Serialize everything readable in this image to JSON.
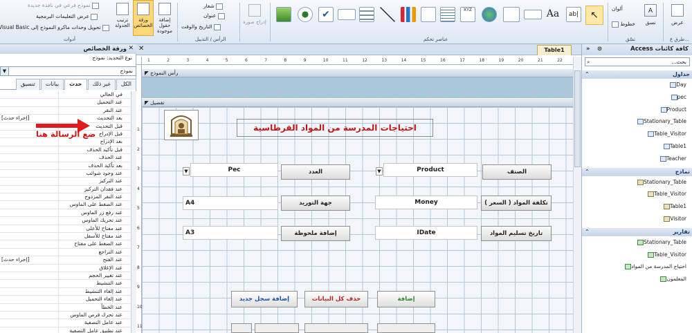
{
  "ribbon": {
    "groups": [
      {
        "label": "طرق ع..."
      },
      {
        "label": "نسّق"
      },
      {
        "label": "عناصر تحكم"
      },
      {
        "label": "الرأس / التذييل"
      },
      {
        "label": "أدوات"
      }
    ],
    "view_label": "عرض",
    "theme_label": "نسق",
    "colors_label": "ألوان",
    "fonts_label": "خطوط",
    "insert_image_label": "إدراج صورة",
    "logo_label": "شعار",
    "title_label": "عنوان",
    "datetime_label": "التاريخ والوقت",
    "add_fields_label": "إضافة حقول موجودة",
    "property_sheet_label": "ورقة الخصائص",
    "tab_order_label": "ترتيب الجدولة",
    "subform_label": "نموذج فرعي في نافذة جديدة",
    "view_code_label": "عرض التعليمات البرمجية",
    "convert_macros_label": "تحويل وحدات ماكرو النموذج إلى Visual Basic",
    "label_control": "Aa",
    "textbox_control": "ab|",
    "xyz_control": "XYZ"
  },
  "property_sheet": {
    "title": "ورقة الخصائص",
    "selection_type": "نوع التحديد: نموذج",
    "selected_object": "نموذج",
    "tabs": [
      "تنسيق",
      "بيانات",
      "حدث",
      "غير ذلك",
      "الكل"
    ],
    "active_tab": "حدث",
    "events": [
      {
        "name": "في الحالي",
        "value": ""
      },
      {
        "name": "عند التحميل",
        "value": ""
      },
      {
        "name": "عند النقر",
        "value": ""
      },
      {
        "name": "بعد التحديث",
        "value": "[إجراء حدث]"
      },
      {
        "name": "قبل التحديث",
        "value": ""
      },
      {
        "name": "قبل الإدراج",
        "value": ""
      },
      {
        "name": "بعد الإدراج",
        "value": ""
      },
      {
        "name": "قبل تأكيد الحذف",
        "value": ""
      },
      {
        "name": "عند الحذف",
        "value": ""
      },
      {
        "name": "بعد تأكيد الحذف",
        "value": ""
      },
      {
        "name": "عند وجود شوائب",
        "value": ""
      },
      {
        "name": "عند التركيز",
        "value": ""
      },
      {
        "name": "عند فقدان التركيز",
        "value": ""
      },
      {
        "name": "عند النقر المزدوج",
        "value": ""
      },
      {
        "name": "عند الضغط على الماوس",
        "value": ""
      },
      {
        "name": "عند رفع زر الماوس",
        "value": ""
      },
      {
        "name": "عند تحريك الماوس",
        "value": ""
      },
      {
        "name": "عند مفتاح للأعلى",
        "value": ""
      },
      {
        "name": "عند مفتاح للأسفل",
        "value": ""
      },
      {
        "name": "عند الضغط على مفتاح",
        "value": ""
      },
      {
        "name": "عند التراجع",
        "value": ""
      },
      {
        "name": "عند الفتح",
        "value": "[إجراء حدث]"
      },
      {
        "name": "عند الإغلاق",
        "value": ""
      },
      {
        "name": "عند تغيير الحجم",
        "value": ""
      },
      {
        "name": "عند التنشيط",
        "value": ""
      },
      {
        "name": "عند إلغاء التنشيط",
        "value": ""
      },
      {
        "name": "عند إلغاء التحميل",
        "value": ""
      },
      {
        "name": "عند الخطأ",
        "value": ""
      },
      {
        "name": "عند تحرك قرص الماوس",
        "value": ""
      },
      {
        "name": "عند عامل التصفية",
        "value": ""
      },
      {
        "name": "عند تطبيق عامل التصفية",
        "value": ""
      }
    ],
    "annotation": "ضع الرسالة هنا"
  },
  "document": {
    "tab_label": "Table1",
    "header_section": "رأس النموذج",
    "detail_section": "تفصيل",
    "ruler_numbers": [
      "1",
      "2",
      "3",
      "4",
      "5",
      "6",
      "7",
      "8",
      "9",
      "10",
      "11",
      "12",
      "13",
      "14",
      "15",
      "16",
      "17",
      "18",
      "19",
      "20",
      "21",
      "22"
    ],
    "vruler_numbers": [
      "1",
      "2",
      "3",
      "4",
      "5",
      "6",
      "7",
      "8",
      "9",
      "10",
      "11"
    ],
    "title": "احتياجات المدرسة من المواد القرطاسية",
    "labels": {
      "category": "الصنف",
      "count": "العدد",
      "cost": "تكلفة المواد ( السعر )",
      "supplier": "جهة التوريد",
      "delivery_date": "تاريخ تسليم المواد",
      "note": "إضافة ملحوظة"
    },
    "fields": {
      "product": "Product",
      "pec": "Pec",
      "money": "Money",
      "a4": "A4",
      "idate": "IDate",
      "a3": "A3"
    },
    "buttons": {
      "add": "إضافة",
      "delete_all": "حذف كل البيانات",
      "new_record": "إضافة سجل جديد"
    }
  },
  "nav_pane": {
    "title": "كافة كائنات Access",
    "search_placeholder": "بحث...",
    "groups": [
      {
        "title": "جداول",
        "items": [
          "Day",
          "pec",
          "Product",
          "Stationary_Table",
          "Table_Visitor",
          "Table1",
          "Teacher"
        ]
      },
      {
        "title": "نماذج",
        "items": [
          "Stationary_Table",
          "Table_Visitor",
          "Table1",
          "Visitor"
        ]
      },
      {
        "title": "تقارير",
        "items": [
          "Stationary_Table",
          "Table_Visitor",
          "احتياج المدرسة من المواد",
          "المعلمون"
        ]
      }
    ]
  }
}
